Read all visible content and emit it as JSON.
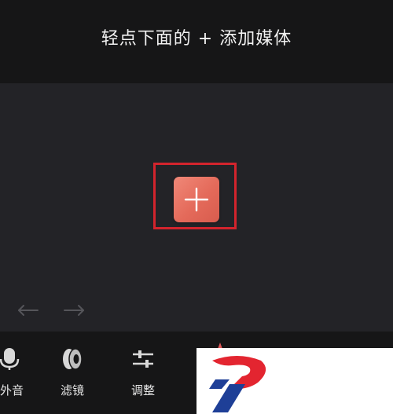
{
  "hint": {
    "text": "轻点下面的 + 添加媒体"
  },
  "canvas": {
    "add_media_icon": "plus-icon",
    "undo_icon": "undo-arrow-icon",
    "redo_icon": "redo-arrow-icon"
  },
  "toolbar": {
    "items": [
      {
        "label": "外音",
        "icon": "microphone-icon"
      },
      {
        "label": "滤镜",
        "icon": "filter-icon"
      },
      {
        "label": "调整",
        "icon": "sliders-icon"
      }
    ]
  },
  "colors": {
    "accent": "#e46a5a",
    "highlight_border": "#d3242d",
    "background": "#232327",
    "bars": "#161617"
  }
}
